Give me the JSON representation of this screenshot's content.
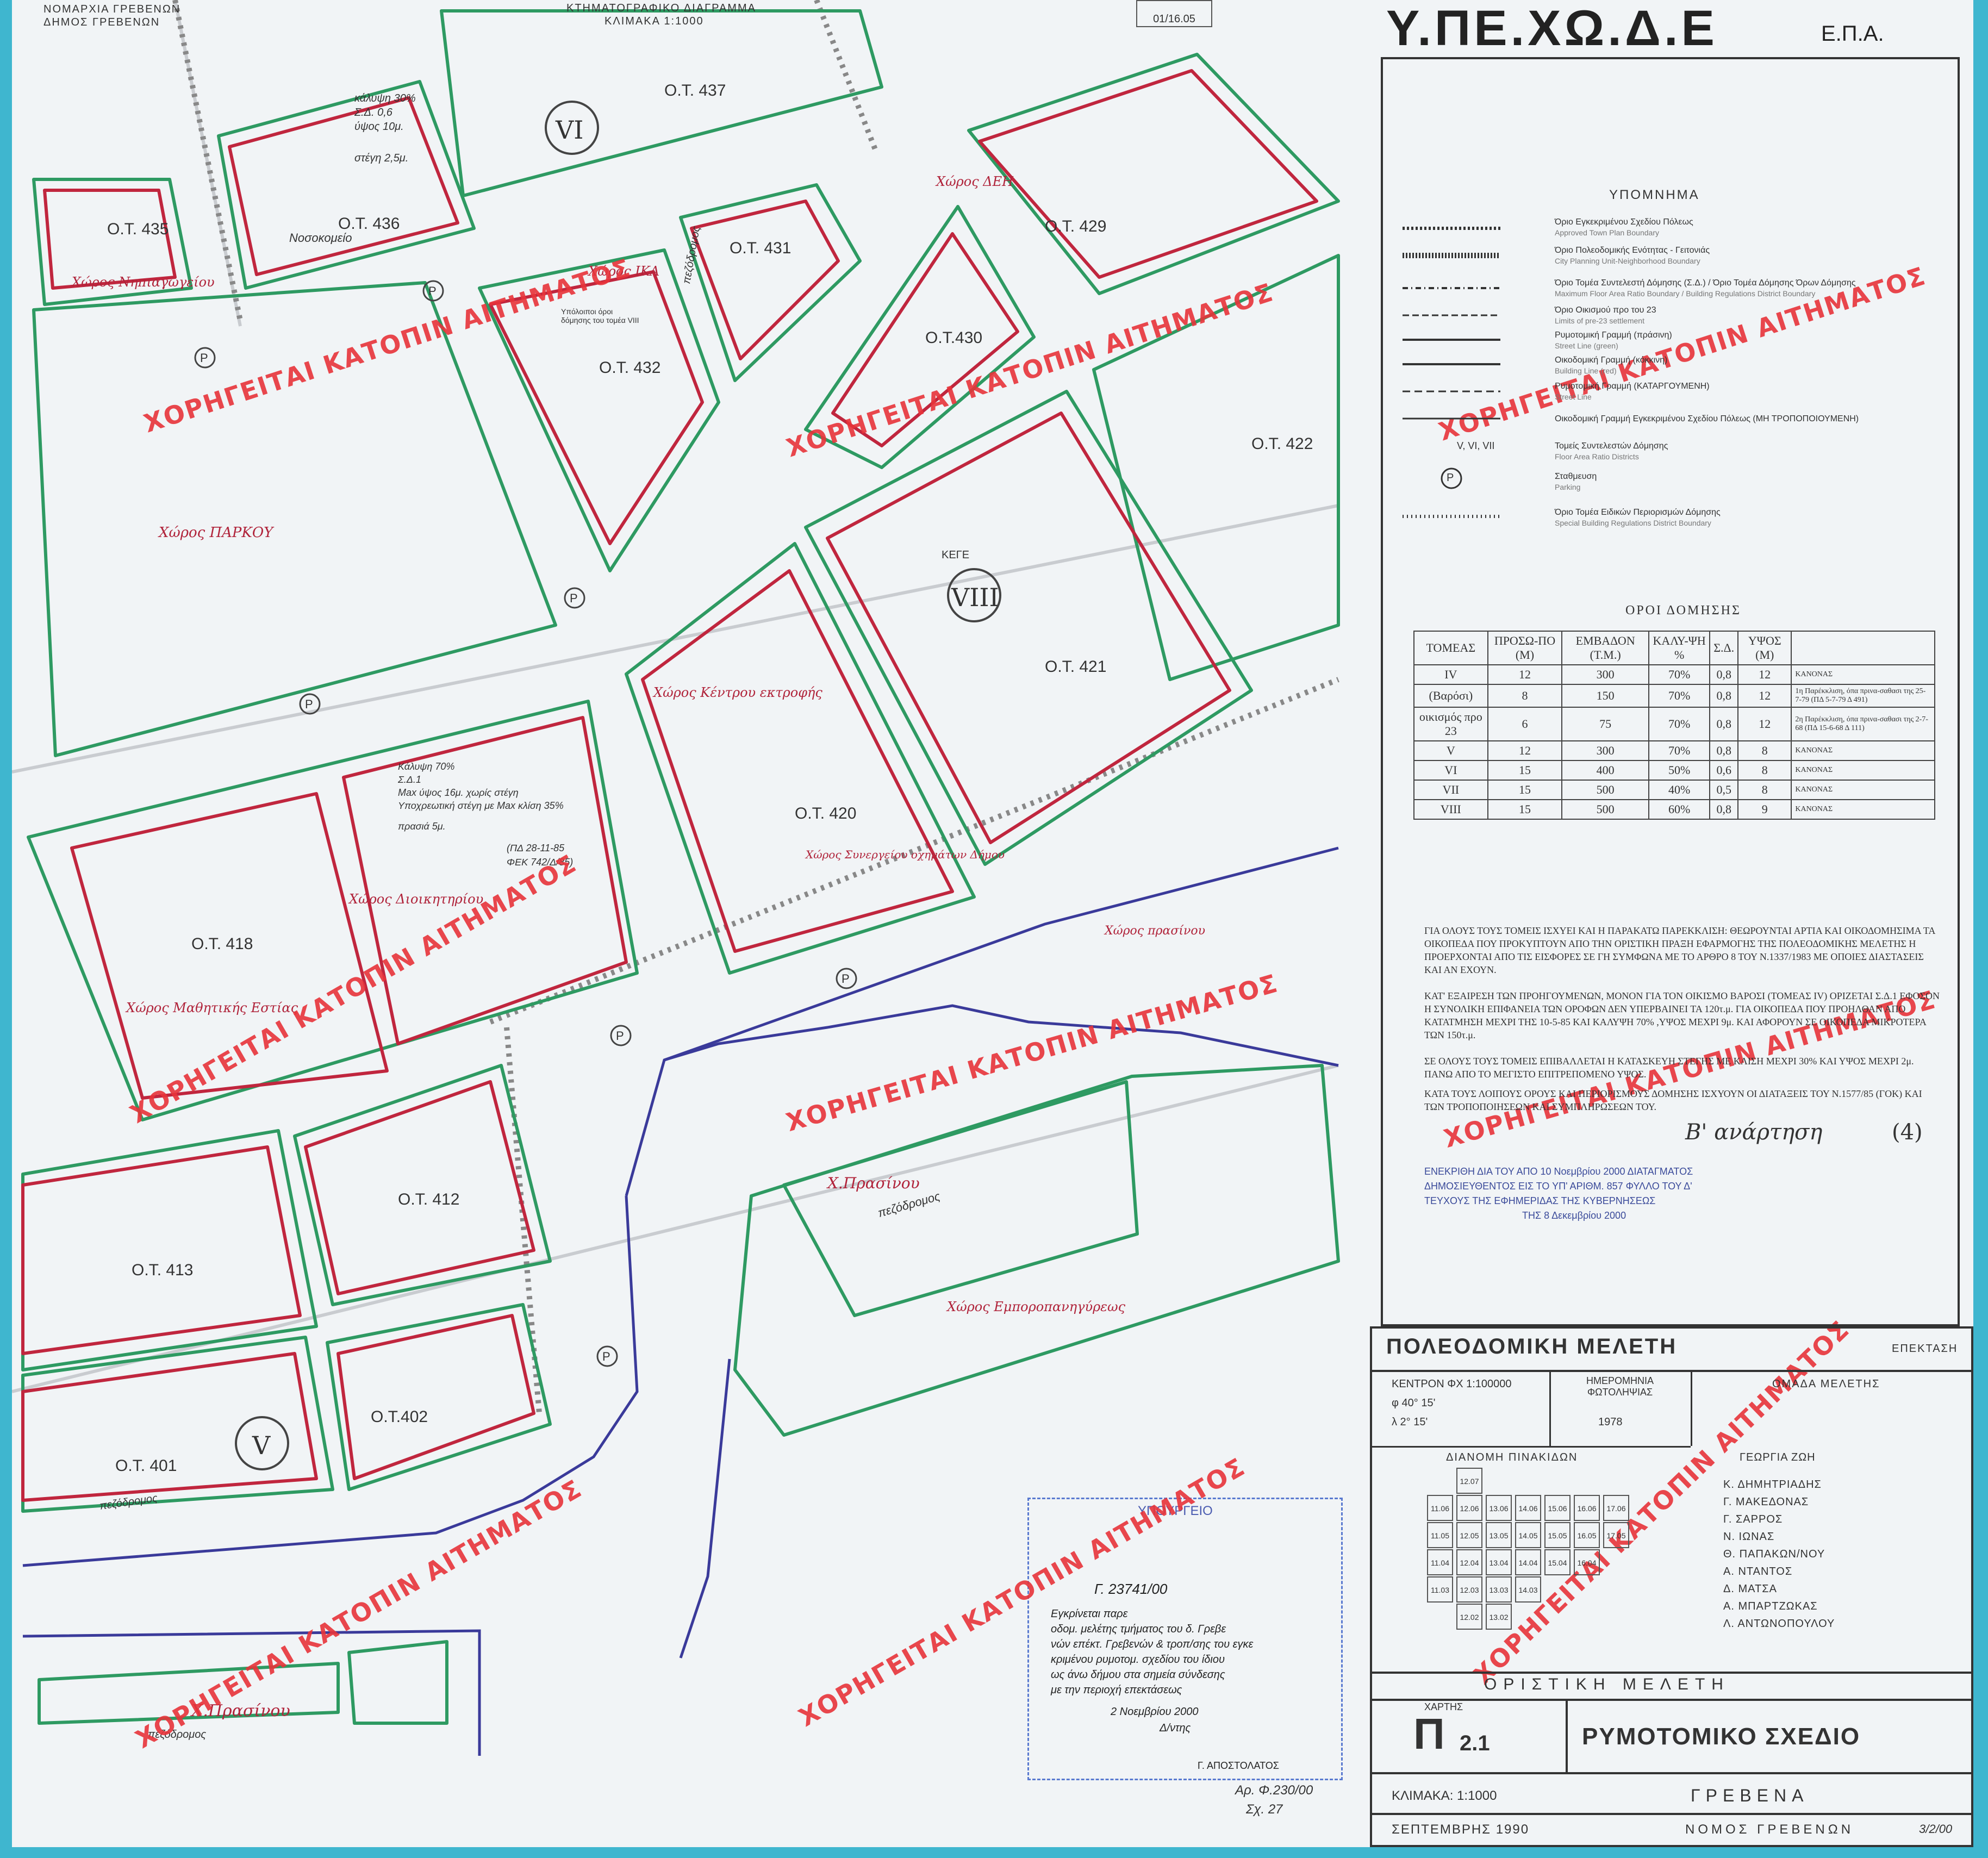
{
  "header": {
    "prefecture_line1": "ΝΟΜΑΡΧΙΑ ΓΡΕΒΕΝΩΝ",
    "prefecture_line2": "ΔΗΜΟΣ ΓΡΕΒΕΝΩΝ",
    "cadastral_title": "ΚΤΗΜΑΤΟΓΡΑΦΙΚΟ ΔΙΑΓΡΑΜΜΑ",
    "cadastral_scale": "ΚΛΙΜΑΚΑ 1:1000",
    "date_box": "01/16.05",
    "ministry": "Υ.ΠΕ.ΧΩ.Δ.Ε",
    "ministry_suffix": "Ε.Π.Α."
  },
  "map": {
    "blocks": [
      {
        "label": "Ο.Τ. 437"
      },
      {
        "label": "Ο.Τ. 435"
      },
      {
        "label": "Ο.Τ. 436"
      },
      {
        "label": "Ο.Τ. 431"
      },
      {
        "label": "Ο.Τ. 429"
      },
      {
        "label": "Ο.Τ.430"
      },
      {
        "label": "Ο.Τ. 432"
      },
      {
        "label": "Ο.Τ. 422"
      },
      {
        "label": "Ο.Τ. 421"
      },
      {
        "label": "Ο.Τ. 420"
      },
      {
        "label": "Ο.Τ. 418"
      },
      {
        "label": "Ο.Τ. 412"
      },
      {
        "label": "Ο.Τ. 413"
      },
      {
        "label": "Ο.Τ.402"
      },
      {
        "label": "Ο.Τ. 401"
      }
    ],
    "sectors": [
      "VI",
      "VIII",
      "V"
    ],
    "hand_notes": [
      {
        "text": "Χώρος Νηπιαγωγείου"
      },
      {
        "text": "Νοσοκομείο"
      },
      {
        "text": "Χώρος ΙΚΑ"
      },
      {
        "text": "Χώρος ΔΕΗ"
      },
      {
        "text": "Χώρος ΠΑΡΚΟΥ"
      },
      {
        "text": "Χώρος Κέντρου εκτροφής"
      },
      {
        "text": "Χώρος Συνεργείου οχημάτων Δήμου"
      },
      {
        "text": "Χώρος Διοικητηρίου"
      },
      {
        "text": "Χώρος Μαθητικής Εστίας"
      },
      {
        "text": "Χώρος πρασίνου"
      },
      {
        "text": "Χ.Πρασίνου"
      },
      {
        "text": "Χώρος Εμποροπανηγύρεως"
      },
      {
        "text": "Χ.Πρασίνου"
      }
    ],
    "sidewalk_labels": [
      "πεζόδρομος",
      "πεζόδρομος",
      "πεζόδρομος",
      "πεζόδρομος"
    ],
    "building_notes": [
      "κάλυψη 30%",
      "Σ.Δ. 0,6",
      "ύψος 10μ.",
      "στέγη 2,5μ."
    ],
    "building_notes2": [
      "Κάλυψη 70%",
      "Σ.Δ.1",
      "Max ύψος 16μ. χωρίς στέγη",
      "Υποχρεωτική στέγη με Max κλίση 35%",
      "πρασιά 5μ."
    ],
    "decision_notes": [
      "(ΠΔ 28-11-85",
      "ΦΕΚ 742/Δ/85)"
    ],
    "other_labels": {
      "kege": "ΚΕΓΕ",
      "parking": "P",
      "orioi": "Υπόλοιποι όροι δόμησης του τομέα VIII"
    }
  },
  "stamps": [
    "ΧΟΡΗΓΕΙΤΑΙ ΚΑΤΟΠΙΝ ΑΙΤΗΜΑΤΟΣ"
  ],
  "approval_stamp": {
    "org": "ΥΠΟΥΡΓΕΙΟ",
    "ref": "Γ. 23741/00",
    "text": [
      "Εγκρίνεται παρε",
      "οδομ. μελέτης τμήματος του δ. Γρεβε",
      "νών επέκτ. Γρεβενών & τροπ/σης του εγκε",
      "κριμένου ρυμοτομ. σχεδίου του ίδιου",
      "ως άνω δήμου στα σημεία σύνδεσης",
      "με την περιοχή επεκτάσεως"
    ],
    "date": "2 Νοεμβρίου 2000",
    "sign": "Δ/ντης",
    "signer": "Γ. ΑΠΟΣΤΟΛΑΤΟΣ",
    "file_ref": "Αρ. Φ.230/00",
    "file_ref2": "Σχ. 27"
  },
  "legend": {
    "title": "ΥΠΟΜΝΗΜΑ",
    "items": [
      {
        "gr": "Όριο Εγκεκριμένου Σχεδίου Πόλεως",
        "en": "Approved Town Plan Boundary"
      },
      {
        "gr": "Όριο Πολεοδομικής Ενότητας - Γειτονιάς",
        "en": "City Planning Unit-Neighborhood Boundary"
      },
      {
        "gr": "Όριο Τομέα Συντελεστή Δόμησης (Σ.Δ.) / Όριο Τομέα Δόμησης Όρων Δόμησης",
        "en": "Maximum Floor Area Ratio Boundary / Building Regulations District Boundary"
      },
      {
        "gr": "Όριο Οικισμού προ του 23",
        "en": "Limits of pre-23 settlement"
      },
      {
        "gr": "Ρυμοτομική Γραμμή (πράσινη)",
        "en": "Street Line (green)"
      },
      {
        "gr": "Οικοδομική Γραμμή (κόκκινη)",
        "en": "Building Line (red)"
      },
      {
        "gr": "Ρυμοτομική Γραμμή (ΚΑΤΑΡΓΟΥΜΕΝΗ)",
        "en": "Street Line"
      },
      {
        "gr": "Οικοδομική Γραμμή Εγκεκριμένου Σχεδίου Πόλεως (ΜΗ ΤΡΟΠΟΠΟΙΟΥΜΕΝΗ)",
        "en": ""
      },
      {
        "gr": "Τομείς Συντελεστών Δόμησης",
        "en": "Floor Area Ratio Districts",
        "sym": "V, VI, VII"
      },
      {
        "gr": "Σταθμευση",
        "en": "Parking",
        "sym": "P"
      },
      {
        "gr": "Όριο Τομέα Ειδικών Περιορισμών Δόμησης",
        "en": "Special Building Regulations District Boundary"
      }
    ]
  },
  "building_terms": {
    "title": "ΟΡΟΙ ΔΟΜΗΣΗΣ",
    "headers": [
      "ΤΟΜΕΑΣ",
      "ΠΡΟΣΩ-ΠΟ (Μ)",
      "ΕΜΒΑΔΟΝ (Τ.Μ.)",
      "ΚΑΛΥ-ΨΗ %",
      "Σ.Δ.",
      "ΥΨΟΣ (Μ)",
      ""
    ],
    "rows": [
      [
        "IV",
        "12",
        "300",
        "70%",
        "0,8",
        "12",
        "ΚΑΝΟΝΑΣ"
      ],
      [
        "(Βαρόσι)",
        "8",
        "150",
        "70%",
        "0,8",
        "12",
        "1η Παρέκκλιση, όπα πρινα-σαθασι της 25-7-79 (ΠΔ 5-7-79 Δ 491)"
      ],
      [
        "οικισμός προ 23",
        "6",
        "75",
        "70%",
        "0,8",
        "12",
        "2η Παρέκκλιση, όπα πρινα-σαθασι της 2-7-68 (ΠΔ 15-6-68 Δ 111)"
      ],
      [
        "V",
        "12",
        "300",
        "70%",
        "0,8",
        "8",
        "ΚΑΝΟΝΑΣ"
      ],
      [
        "VI",
        "15",
        "400",
        "50%",
        "0,6",
        "8",
        "ΚΑΝΟΝΑΣ"
      ],
      [
        "VII",
        "15",
        "500",
        "40%",
        "0,5",
        "8",
        "ΚΑΝΟΝΑΣ"
      ],
      [
        "VIII",
        "15",
        "500",
        "60%",
        "0,8",
        "9",
        "ΚΑΝΟΝΑΣ"
      ]
    ],
    "notes": [
      "ΓΙΑ ΟΛΟΥΣ ΤΟΥΣ ΤΟΜΕΙΣ ΙΣΧΥΕΙ ΚΑΙ Η ΠΑΡΑΚΑΤΩ ΠΑΡΕΚΚΛΙΣΗ: ΘΕΩΡΟΥΝΤΑΙ ΑΡΤΙΑ ΚΑΙ ΟΙΚΟΔΟΜΗΣΙΜΑ ΤΑ ΟΙΚΟΠΕΔΑ ΠΟΥ ΠΡΟΚΥΠΤΟΥΝ ΑΠΟ ΤΗΝ ΟΡΙΣΤΙΚΗ ΠΡΑΞΗ ΕΦΑΡΜΟΓΗΣ ΤΗΣ ΠΟΛΕΟΔΟΜΙΚΗΣ ΜΕΛΕΤΗΣ Η ΠΡΟΕΡΧΟΝΤΑΙ ΑΠΟ ΤΙΣ ΕΙΣΦΟΡΕΣ ΣΕ ΓΗ ΣΥΜΦΩΝΑ ΜΕ ΤΟ ΑΡΘΡΟ 8 ΤΟΥ Ν.1337/1983 ΜΕ ΟΠΟΙΕΣ ΔΙΑΣΤΑΣΕΙΣ ΚΑΙ ΑΝ ΕΧΟΥΝ.",
      "ΚΑΤ' ΕΞΑΙΡΕΣΗ ΤΩΝ ΠΡΟΗΓΟΥΜΕΝΩΝ, ΜΟΝΟΝ ΓΙΑ ΤΟΝ ΟΙΚΙΣΜΟ ΒΑΡΟΣΙ (ΤΟΜΕΑΣ IV) ΟΡΙΖΕΤΑΙ Σ.Δ.1 ΕΦΟΣΟΝ Η ΣΥΝΟΛΙΚΗ ΕΠΙΦΑΝΕΙΑ ΤΩΝ ΟΡΟΦΩΝ ΔΕΝ ΥΠΕΡΒΑΙΝΕΙ ΤΑ 120τ.μ. ΓΙΑ ΟΙΚΟΠΕΔΑ ΠΟΥ ΠΡΟΗΛΘΑΝ ΑΠΟ ΚΑΤΑΤΜΗΣΗ ΜΕΧΡΙ ΤΗΣ 10-5-85 ΚΑΙ ΚΑΛΥΨΗ 70% ,ΥΨΟΣ ΜΕΧΡΙ 9μ. ΚΑΙ ΑΦΟΡΟΥΝ ΣΕ ΟΙΚΟΠΕΔΑ ΜΙΚΡΟΤΕΡΑ ΤΩΝ 150τ.μ.",
      "ΣΕ ΟΛΟΥΣ ΤΟΥΣ ΤΟΜΕΙΣ ΕΠΙΒΑΛΛΕΤΑΙ Η ΚΑΤΑΣΚΕΥΗ ΣΤΕΓΗΣ ΜΕ ΚΛΙΣΗ ΜΕΧΡΙ 30% ΚΑΙ ΥΨΟΣ ΜΕΧΡΙ 2μ. ΠΑΝΩ ΑΠΟ ΤΟ ΜΕΓΙΣΤΟ ΕΠΙΤΡΕΠΟΜΕΝΟ ΥΨΟΣ.",
      "ΚΑΤΑ ΤΟΥΣ ΛΟΙΠΟΥΣ ΟΡΟΥΣ ΚΑΙ ΠΕΡΙΟΡΙΣΜΟΥΣ ΔΟΜΗΣΗΣ ΙΣΧΥΟΥΝ ΟΙ ΔΙΑΤΑΞΕΙΣ ΤΟΥ Ν.1577/85 (ΓΟΚ) ΚΑΙ ΤΩΝ ΤΡΟΠΟΠΟΙΗΣΕΩΝ ΚΑΙ ΣΥΜΠΛΗΡΩΣΕΩΝ ΤΟΥ."
    ],
    "handwritten": "Β' ανάρτηση",
    "handwritten_num": "(4)"
  },
  "approval_text": {
    "line1": "ΕΝΕΚΡΙΘΗ ΔΙΑ ΤΟΥ ΑΠΟ 10 Νοεμβρίου 2000 ΔΙΑΤΑΓΜΑΤΟΣ",
    "line2": "ΔΗΜΟΣΙΕΥΘΕΝΤΟΣ ΕΙΣ ΤΟ ΥΠ' ΑΡΙΘΜ. 857 ΦΥΛΛΟ ΤΟΥ Δ'",
    "line3": "ΤΕΥΧΟΥΣ ΤΗΣ ΕΦΗΜΕΡΙΔΑΣ ΤΗΣ ΚΥΒΕΡΝΗΣΕΩΣ",
    "line4": "ΤΗΣ 8 Δεκεμβρίου 2000"
  },
  "title_block": {
    "study": "ΠΟΛΕΟΔΟΜΙΚΗ ΜΕΛΕΤΗ",
    "extension": "ΕΠΕΚΤΑΣΗ",
    "center": "ΚΕΝΤΡΟΝ ΦΧ 1:100000",
    "phi": "φ   40° 15'",
    "lambda": "λ    2° 15'",
    "date_label": "ΗΜΕΡΟΜΗΝΙΑ ΦΩΤΟΛΗΨΙΑΣ",
    "date_value": "1978",
    "team_title": "ΟΜΑΔΑ ΜΕΛΕΤΗΣ",
    "sheets_title": "ΔΙΑΝΟΜΗ ΠΙΝΑΚΙΔΩΝ",
    "team": [
      "ΓΕΩΡΓΙΑ ΖΩΗ",
      "Κ. ΔΗΜΗΤΡΙΑΔΗΣ",
      "Γ. ΜΑΚΕΔΟΝΑΣ",
      "Γ. ΣΑΡΡΟΣ",
      "Ν. ΙΩΝΑΣ",
      "Θ. ΠΑΠΑΚΩΝ/ΝΟΥ",
      "Α. ΝΤΑΝΤΟΣ",
      "Δ. ΜΑΤΣΑ",
      "Α. ΜΠΑΡΤΖΩΚΑΣ",
      "Λ. ΑΝΤΩΝΟΠΟΥΛΟΥ"
    ],
    "sheet_rows": [
      [
        "",
        "12.07",
        "",
        "",
        "",
        "",
        "",
        ""
      ],
      [
        "11.06",
        "12.06",
        "13.06",
        "14.06",
        "15.06",
        "16.06",
        "17.06"
      ],
      [
        "11.05",
        "12.05",
        "13.05",
        "14.05",
        "15.05",
        "16.05",
        "17.05"
      ],
      [
        "11.04",
        "12.04",
        "13.04",
        "14.04",
        "15.04",
        "16.04"
      ],
      [
        "11.03",
        "12.03",
        "13.03",
        "14.03"
      ],
      [
        "",
        "12.02",
        "13.02"
      ]
    ],
    "final_study": "ΟΡΙΣΤΙΚΗ ΜΕΛΕΤΗ",
    "map_label": "ΧΑΡΤΗΣ",
    "map_code": "Π",
    "map_num": "2.1",
    "plan_title": "ΡΥΜΟΤΟΜΙΚΟ ΣΧΕΔΙΟ",
    "scale": "ΚΛΙΜΑΚΑ: 1:1000",
    "city": "ΓΡΕΒΕΝΑ",
    "date": "ΣΕΠΤΕΜΒΡΗΣ 1990",
    "prefecture": "ΝΟΜΟΣ ΓΡΕΒΕΝΩΝ",
    "hand_date": "3/2/00"
  },
  "colors": {
    "green": "#2e9a62",
    "red": "#c0263e",
    "blue": "#3a3a9a",
    "stamp": "#e8343a",
    "frame": "#3fb6cf"
  }
}
